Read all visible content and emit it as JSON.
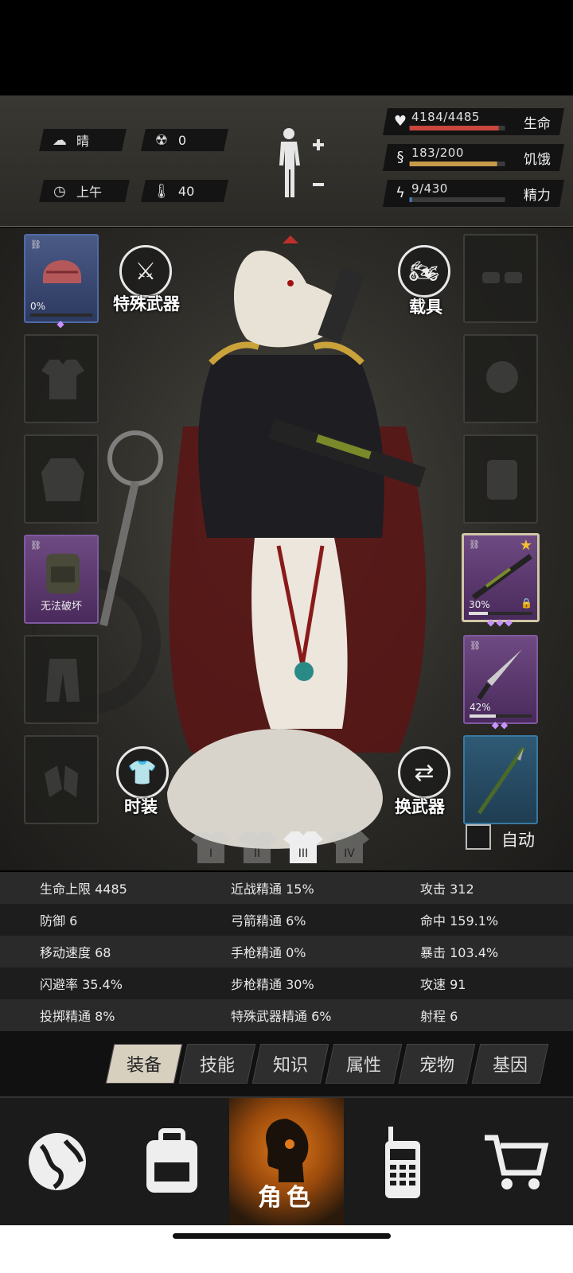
{
  "hud": {
    "weather": "晴",
    "radiation": "0",
    "time": "上午",
    "temperature": "40",
    "bars": [
      {
        "name": "生命",
        "value": "4184/4485",
        "fill_fraction": 0.933,
        "color": "#c8463c",
        "icon": "heart-icon"
      },
      {
        "name": "饥饿",
        "value": "183/200",
        "fill_fraction": 0.915,
        "color": "#c79a4a",
        "icon": "stomach-icon"
      },
      {
        "name": "精力",
        "value": "9/430",
        "fill_fraction": 0.021,
        "color": "#4a7fb0",
        "icon": "energy-head-icon"
      }
    ]
  },
  "stage": {
    "special_weapon_label": "特殊武器",
    "vehicle_label": "载具",
    "fashion_label": "时装",
    "switch_weapon_label": "换武器",
    "auto_label": "自动",
    "slots": {
      "helmet_pct": "0%",
      "helmet_durability": 0.0,
      "backpack_caption": "无法破坏",
      "rifle_pct": "30%",
      "rifle_durability": 0.3,
      "knife_pct": "42%",
      "knife_durability": 0.42
    },
    "outfit_tabs": [
      "I",
      "II",
      "III",
      "IV"
    ]
  },
  "stats": [
    [
      "生命上限 4485",
      "近战精通 15%",
      "攻击 312"
    ],
    [
      "防御 6",
      "弓箭精通 6%",
      "命中 159.1%"
    ],
    [
      "移动速度 68",
      "手枪精通 0%",
      "暴击 103.4%"
    ],
    [
      "闪避率 35.4%",
      "步枪精通 30%",
      "攻速 91"
    ],
    [
      "投掷精通 8%",
      "特殊武器精通 6%",
      "射程 6"
    ]
  ],
  "subtabs": [
    "装备",
    "技能",
    "知识",
    "属性",
    "宠物",
    "基因"
  ],
  "nav": {
    "items": [
      "globe-icon",
      "backpack-icon",
      "character-icon",
      "radio-icon",
      "cart-icon"
    ],
    "active_label": "角色"
  }
}
